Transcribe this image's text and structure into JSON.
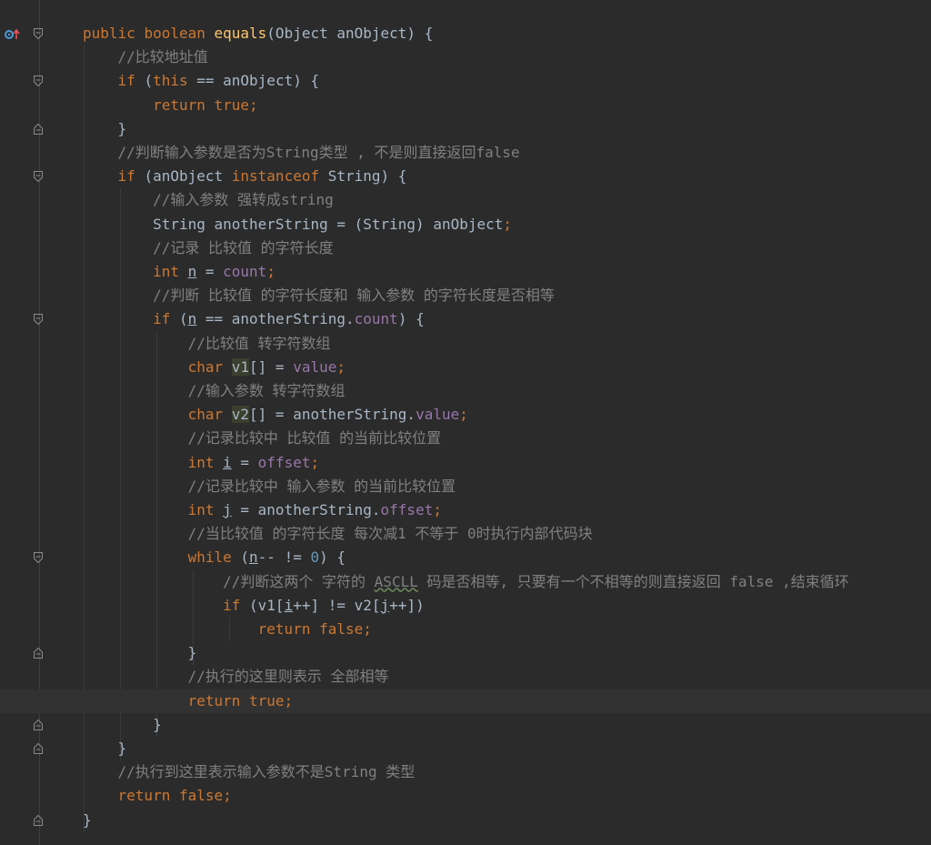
{
  "editor": {
    "lines": [
      [
        {
          "t": "public ",
          "c": "kw"
        },
        {
          "t": "boolean ",
          "c": "kw"
        },
        {
          "t": "equals",
          "c": "fn"
        },
        {
          "t": "(Object anObject) {",
          "c": "pl"
        }
      ],
      [
        {
          "t": "    //比较地址值",
          "c": "cm"
        }
      ],
      [
        {
          "t": "    ",
          "c": "pl"
        },
        {
          "t": "if ",
          "c": "kw"
        },
        {
          "t": "(",
          "c": "pl"
        },
        {
          "t": "this",
          "c": "kw"
        },
        {
          "t": " == anObject) {",
          "c": "pl"
        }
      ],
      [
        {
          "t": "        ",
          "c": "pl"
        },
        {
          "t": "return true;",
          "c": "kw"
        }
      ],
      [
        {
          "t": "    }",
          "c": "pl"
        }
      ],
      [
        {
          "t": "    //判断输入参数是否为String类型 , 不是则直接返回false",
          "c": "cm"
        }
      ],
      [
        {
          "t": "    ",
          "c": "pl"
        },
        {
          "t": "if ",
          "c": "kw"
        },
        {
          "t": "(anObject ",
          "c": "pl"
        },
        {
          "t": "instanceof ",
          "c": "kw"
        },
        {
          "t": "String) {",
          "c": "pl"
        }
      ],
      [
        {
          "t": "        //输入参数 强转成string",
          "c": "cm"
        }
      ],
      [
        {
          "t": "        String anotherString = (String) anObject",
          "c": "pl"
        },
        {
          "t": ";",
          "c": "kw"
        }
      ],
      [
        {
          "t": "        //记录 比较值 的字符长度",
          "c": "cm"
        }
      ],
      [
        {
          "t": "        ",
          "c": "pl"
        },
        {
          "t": "int ",
          "c": "kw"
        },
        {
          "t": "n",
          "c": "pl ul"
        },
        {
          "t": " = ",
          "c": "pl"
        },
        {
          "t": "count",
          "c": "fld"
        },
        {
          "t": ";",
          "c": "kw"
        }
      ],
      [
        {
          "t": "        //判断 比较值 的字符长度和 输入参数 的字符长度是否相等",
          "c": "cm"
        }
      ],
      [
        {
          "t": "        ",
          "c": "pl"
        },
        {
          "t": "if ",
          "c": "kw"
        },
        {
          "t": "(",
          "c": "pl"
        },
        {
          "t": "n",
          "c": "pl ul"
        },
        {
          "t": " == anotherString.",
          "c": "pl"
        },
        {
          "t": "count",
          "c": "fld"
        },
        {
          "t": ") {",
          "c": "pl"
        }
      ],
      [
        {
          "t": "            //比较值 转字符数组",
          "c": "cm"
        }
      ],
      [
        {
          "t": "            ",
          "c": "pl"
        },
        {
          "t": "char ",
          "c": "kw"
        },
        {
          "t": "v1",
          "c": "pl hl"
        },
        {
          "t": "[] = ",
          "c": "pl"
        },
        {
          "t": "value",
          "c": "fld"
        },
        {
          "t": ";",
          "c": "kw"
        }
      ],
      [
        {
          "t": "            //输入参数 转字符数组",
          "c": "cm"
        }
      ],
      [
        {
          "t": "            ",
          "c": "pl"
        },
        {
          "t": "char ",
          "c": "kw"
        },
        {
          "t": "v2",
          "c": "pl hl"
        },
        {
          "t": "[] = anotherString.",
          "c": "pl"
        },
        {
          "t": "value",
          "c": "fld"
        },
        {
          "t": ";",
          "c": "kw"
        }
      ],
      [
        {
          "t": "            //记录比较中 比较值 的当前比较位置",
          "c": "cm"
        }
      ],
      [
        {
          "t": "            ",
          "c": "pl"
        },
        {
          "t": "int ",
          "c": "kw"
        },
        {
          "t": "i",
          "c": "pl ul"
        },
        {
          "t": " = ",
          "c": "pl"
        },
        {
          "t": "offset",
          "c": "fld"
        },
        {
          "t": ";",
          "c": "kw"
        }
      ],
      [
        {
          "t": "            //记录比较中 输入参数 的当前比较位置",
          "c": "cm"
        }
      ],
      [
        {
          "t": "            ",
          "c": "pl"
        },
        {
          "t": "int ",
          "c": "kw"
        },
        {
          "t": "j",
          "c": "pl ul"
        },
        {
          "t": " = anotherString.",
          "c": "pl"
        },
        {
          "t": "offset",
          "c": "fld"
        },
        {
          "t": ";",
          "c": "kw"
        }
      ],
      [
        {
          "t": "            //当比较值 的字符长度 每次减1 不等于 0时执行内部代码块",
          "c": "cm"
        }
      ],
      [
        {
          "t": "            ",
          "c": "pl"
        },
        {
          "t": "while ",
          "c": "kw"
        },
        {
          "t": "(",
          "c": "pl"
        },
        {
          "t": "n",
          "c": "pl ul"
        },
        {
          "t": "-- != ",
          "c": "pl"
        },
        {
          "t": "0",
          "c": "num"
        },
        {
          "t": ") {",
          "c": "pl"
        }
      ],
      [
        {
          "t": "                //判断这两个 字符的 ",
          "c": "cm"
        },
        {
          "t": "ASCLL",
          "c": "cm squig"
        },
        {
          "t": " 码是否相等, 只要有一个不相等的则直接返回 false ,结束循环",
          "c": "cm"
        }
      ],
      [
        {
          "t": "                ",
          "c": "pl"
        },
        {
          "t": "if ",
          "c": "kw"
        },
        {
          "t": "(v1[",
          "c": "pl"
        },
        {
          "t": "i",
          "c": "pl ul"
        },
        {
          "t": "++] != v2[",
          "c": "pl"
        },
        {
          "t": "j",
          "c": "pl ul"
        },
        {
          "t": "++])",
          "c": "pl"
        }
      ],
      [
        {
          "t": "                    ",
          "c": "pl"
        },
        {
          "t": "return false;",
          "c": "kw"
        }
      ],
      [
        {
          "t": "            }",
          "c": "pl"
        }
      ],
      [
        {
          "t": "            //执行的这里则表示 全部相等",
          "c": "cm"
        }
      ],
      [
        {
          "t": "            ",
          "c": "pl"
        },
        {
          "t": "return true;",
          "c": "kw"
        }
      ],
      [
        {
          "t": "        }",
          "c": "pl"
        }
      ],
      [
        {
          "t": "    }",
          "c": "pl"
        }
      ],
      [
        {
          "t": "    //执行到这里表示输入参数不是String 类型",
          "c": "cm"
        }
      ],
      [
        {
          "t": "    ",
          "c": "pl"
        },
        {
          "t": "return false;",
          "c": "kw"
        }
      ],
      [
        {
          "t": "}",
          "c": "pl"
        }
      ]
    ],
    "current_line": 28,
    "fold_open_lines": [
      0,
      2,
      6,
      12,
      22
    ],
    "fold_close_lines": [
      4,
      26,
      29,
      30,
      33
    ],
    "colors": {
      "background": "#2b2b2b",
      "keyword": "#cc7832",
      "function": "#ffc66d",
      "comment": "#808080",
      "field": "#9876aa",
      "number": "#6897bb",
      "plain": "#a9b7c6",
      "current_line": "#323232"
    },
    "icons": [
      "override-method-icon",
      "fold-open-icon",
      "fold-close-icon"
    ]
  }
}
